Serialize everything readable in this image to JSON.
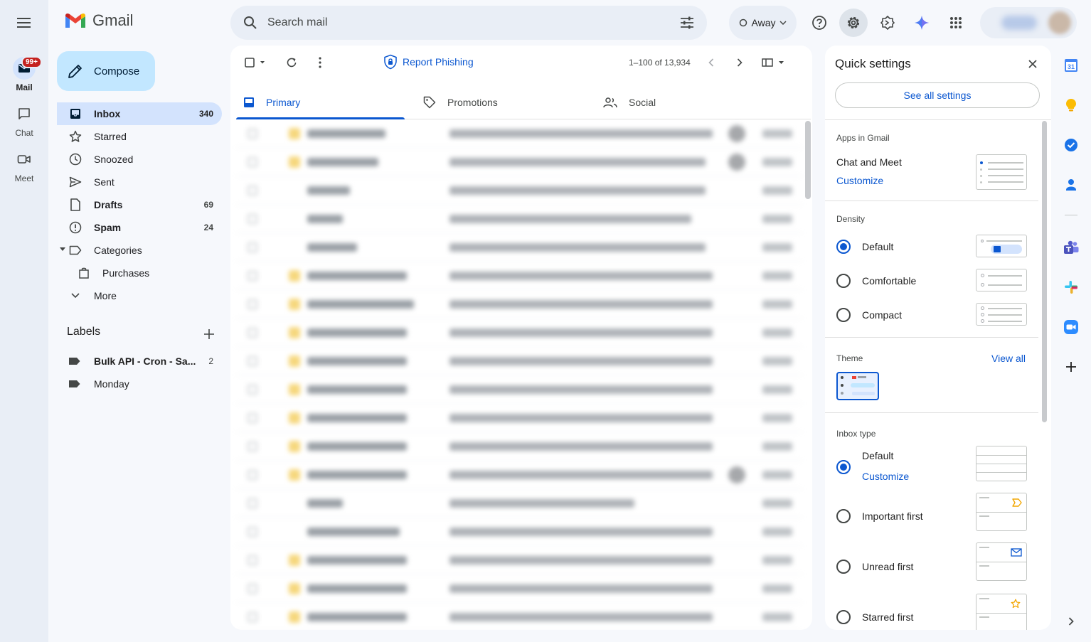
{
  "rail": {
    "mail_badge": "99+",
    "mail_label": "Mail",
    "chat_label": "Chat",
    "meet_label": "Meet"
  },
  "header": {
    "app_name": "Gmail",
    "search_placeholder": "Search mail",
    "status_label": "Away"
  },
  "sidebar": {
    "compose_label": "Compose",
    "items": [
      {
        "label": "Inbox",
        "count": "340"
      },
      {
        "label": "Starred",
        "count": ""
      },
      {
        "label": "Snoozed",
        "count": ""
      },
      {
        "label": "Sent",
        "count": ""
      },
      {
        "label": "Drafts",
        "count": "69"
      },
      {
        "label": "Spam",
        "count": "24"
      },
      {
        "label": "Categories",
        "count": ""
      },
      {
        "label": "Purchases",
        "count": ""
      },
      {
        "label": "More",
        "count": ""
      }
    ],
    "labels_title": "Labels",
    "labels": [
      {
        "label": "Bulk API - Cron - Sa...",
        "count": "2"
      },
      {
        "label": "Monday",
        "count": ""
      }
    ]
  },
  "main": {
    "report_phishing": "Report Phishing",
    "pagination": "1–100 of 13,934",
    "tabs": [
      {
        "label": "Primary"
      },
      {
        "label": "Promotions"
      },
      {
        "label": "Social"
      }
    ]
  },
  "quick_settings": {
    "title": "Quick settings",
    "see_all": "See all settings",
    "apps_header": "Apps in Gmail",
    "chat_meet": "Chat and Meet",
    "customize": "Customize",
    "density_header": "Density",
    "density_options": [
      "Default",
      "Comfortable",
      "Compact"
    ],
    "density_selected": "Default",
    "theme_header": "Theme",
    "view_all": "View all",
    "inbox_type_header": "Inbox type",
    "inbox_options": [
      "Default",
      "Important first",
      "Unread first",
      "Starred first"
    ],
    "inbox_selected": "Default",
    "inbox_customize": "Customize"
  },
  "colors": {
    "accent": "#0b57d0",
    "compose_bg": "#c2e7ff",
    "selected_bg": "#d3e3fd",
    "page_bg": "#f6f8fc",
    "badge": "#c5221f"
  }
}
